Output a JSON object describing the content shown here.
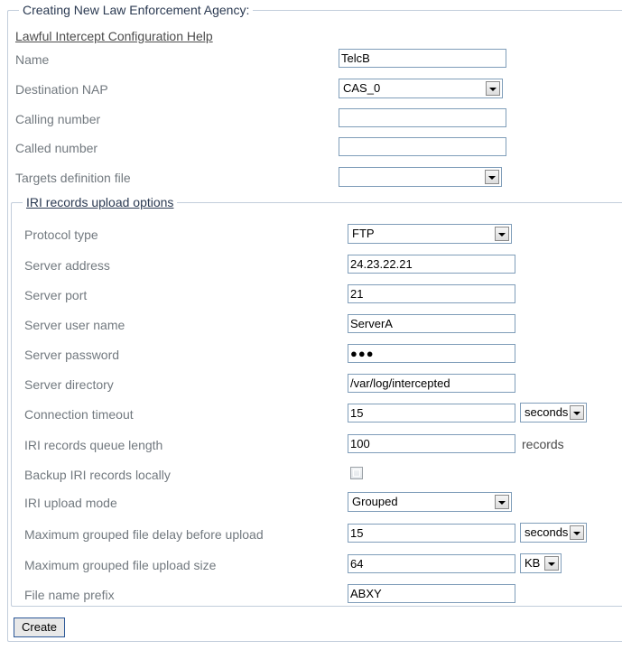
{
  "form": {
    "legend": "Creating New Law Enforcement Agency:",
    "help_link": "Lawful Intercept Configuration Help",
    "submit_label": "Create"
  },
  "basic": {
    "rows": [
      {
        "label": "Name",
        "value": "TelcB",
        "type": "text"
      },
      {
        "label": "Destination NAP",
        "value": "CAS_0",
        "type": "select"
      },
      {
        "label": "Calling number",
        "value": "",
        "type": "text"
      },
      {
        "label": "Called number",
        "value": "",
        "type": "text"
      },
      {
        "label": "Targets definition file",
        "value": "",
        "type": "select"
      }
    ]
  },
  "iri": {
    "legend": "IRI records upload options",
    "rows": [
      {
        "label": "Protocol type",
        "value": "FTP",
        "type": "select"
      },
      {
        "label": "Server address",
        "value": "24.23.22.21",
        "type": "text"
      },
      {
        "label": "Server port",
        "value": "21",
        "type": "text"
      },
      {
        "label": "Server user name",
        "value": "ServerA",
        "type": "text"
      },
      {
        "label": "Server password",
        "value": "●●●",
        "type": "password"
      },
      {
        "label": "Server directory",
        "value": "/var/log/intercepted",
        "type": "text"
      },
      {
        "label": "Connection timeout",
        "value": "15",
        "type": "text",
        "unit_select": "seconds"
      },
      {
        "label": "IRI records queue length",
        "value": "100",
        "type": "text",
        "unit_text": "records"
      },
      {
        "label": "Backup IRI records locally",
        "value": "",
        "type": "checkbox",
        "checked": false
      },
      {
        "label": "IRI upload mode",
        "value": "Grouped",
        "type": "select"
      },
      {
        "label": "Maximum grouped file delay before upload",
        "value": "15",
        "type": "text",
        "unit_select": "seconds"
      },
      {
        "label": "Maximum grouped file upload size",
        "value": "64",
        "type": "text",
        "unit_select": "KB"
      },
      {
        "label": "File name prefix",
        "value": "ABXY",
        "type": "text"
      }
    ]
  },
  "colors": {
    "fieldset_border": "#c2cddb",
    "label_text": "#72797f",
    "legend_text": "#2b3a52",
    "input_border": "#7f9db9",
    "button_border": "#2b5797"
  }
}
